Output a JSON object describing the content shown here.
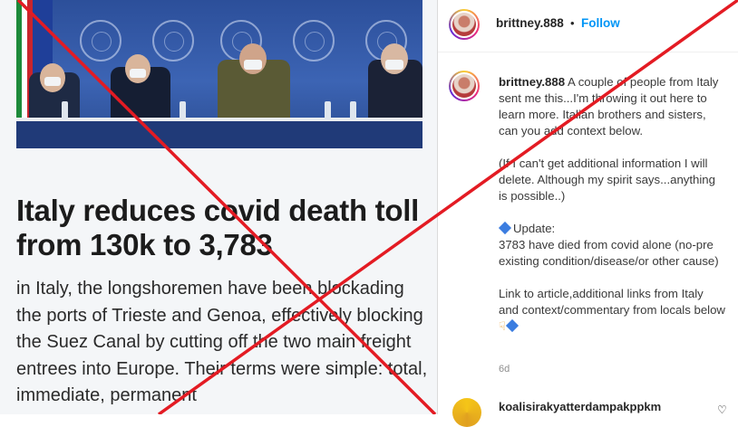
{
  "article": {
    "headline": "Italy reduces covid death toll from 130k to 3,783",
    "body": "in Italy, the longshoremen have been blockading the ports of Trieste and Genoa, effectively blocking the Suez Canal by cutting off the two main freight entrees into Europe. Their terms were simple: total, immediate, permanent"
  },
  "post_header": {
    "username": "brittney.888",
    "separator": "•",
    "follow_label": "Follow",
    "more_icon": "more-horizontal-icon"
  },
  "caption": {
    "username": "brittney.888",
    "paragraph_1": "A couple of people from Italy sent me this...I'm throwing it out here to learn more. Italian brothers and sisters, can you add context below.",
    "paragraph_2": "(If I can't get additional information I will delete. Although my spirit says...anything is possible..)",
    "update_label": "Update:",
    "paragraph_3": "3783 have died from covid alone (no-pre existing condition/disease/or other cause)",
    "paragraph_4": "Link to article,additional links from Italy and context/commentary from locals below",
    "time": "6d"
  },
  "comment": {
    "username": "koalisirakyatterdampakppkm"
  },
  "colors": {
    "overlay_cross": "#e31b23",
    "follow": "#0095f6",
    "diamond": "#3b7de0"
  }
}
